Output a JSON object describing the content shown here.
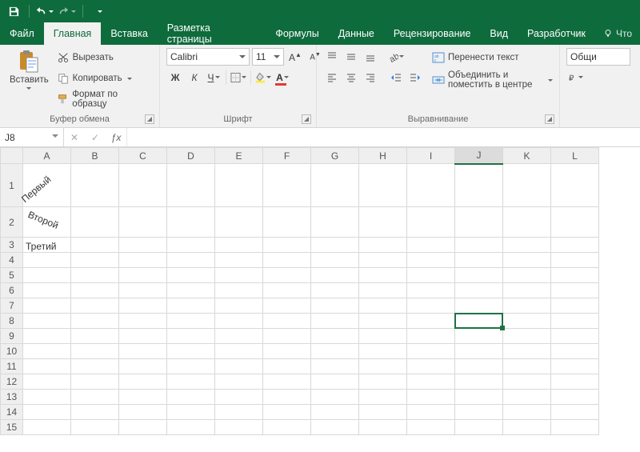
{
  "qat": {
    "save": "save",
    "undo": "undo",
    "redo": "redo",
    "custom": "custom"
  },
  "tabs": {
    "file": "Файл",
    "items": [
      "Главная",
      "Вставка",
      "Разметка страницы",
      "Формулы",
      "Данные",
      "Рецензирование",
      "Вид",
      "Разработчик"
    ],
    "active_index": 0,
    "tell_me": "Что"
  },
  "ribbon": {
    "clipboard": {
      "paste": "Вставить",
      "cut": "Вырезать",
      "copy": "Копировать",
      "format_painter": "Формат по образцу",
      "label": "Буфер обмена"
    },
    "font": {
      "name": "Calibri",
      "size": "11",
      "bold": "Ж",
      "italic": "К",
      "underline": "Ч",
      "label": "Шрифт"
    },
    "align": {
      "wrap": "Перенести текст",
      "merge": "Объединить и поместить в центре",
      "label": "Выравнивание"
    },
    "number": {
      "general": "Общи"
    }
  },
  "namebox": "J8",
  "columns": [
    "A",
    "B",
    "C",
    "D",
    "E",
    "F",
    "G",
    "H",
    "I",
    "J",
    "K",
    "L"
  ],
  "col_widths": {
    "A": 60,
    "default": 60
  },
  "rows": 15,
  "row_heights": {
    "1": 54,
    "2": 38,
    "default": 19
  },
  "cells": {
    "A1": {
      "text": "Первый",
      "rotate": 45
    },
    "A2": {
      "text": "Второй",
      "rotate": -22
    },
    "A3": {
      "text": "Третий"
    }
  },
  "selection": {
    "col": "J",
    "row": 8
  }
}
